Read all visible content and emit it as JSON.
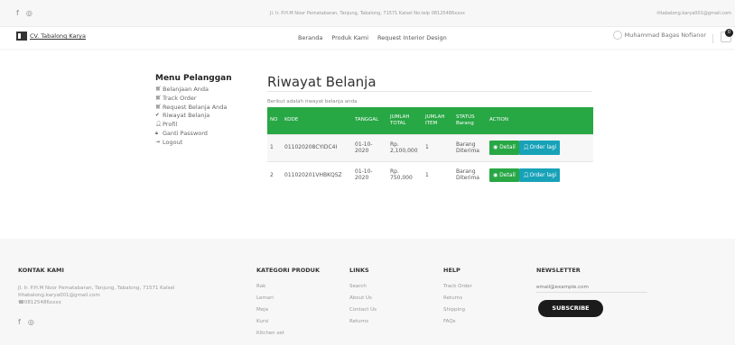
{
  "topbar": {
    "address": "Jl. Ir. P.H.M Noor Pematabaran, Tanjung, Tabalong, 71571 Kalsel No.telp 08125486xxxx",
    "email": "tabalong.karya001@gmail.com"
  },
  "navbar": {
    "brand": "CV. Tabalong Karya",
    "menu": [
      "Beranda",
      "Produk Kami",
      "Request Interior Design"
    ],
    "user_name": "Muhammad Bagas Nofianor",
    "cart_count": "0"
  },
  "sidebar": {
    "title": "Menu Pelanggan",
    "items": [
      {
        "label": "Belanjaan Anda",
        "icon": "cart-icon"
      },
      {
        "label": "Track Order",
        "icon": "cart-icon"
      },
      {
        "label": "Request Belanja Anda",
        "icon": "cart-icon"
      },
      {
        "label": "Riwayat Belanja",
        "icon": "check-icon"
      },
      {
        "label": "Profil",
        "icon": "user-icon"
      },
      {
        "label": "Ganti Password",
        "icon": "lock-icon"
      },
      {
        "label": "Logout",
        "icon": "logout-icon"
      }
    ]
  },
  "main": {
    "title": "Riwayat Belanja",
    "subtitle": "Berikut adalah riwayat belanja anda",
    "table": {
      "headers": [
        "NO",
        "KODE",
        "TANGGAL",
        "JUMLAH TOTAL",
        "JUMLAH ITEM",
        "STATUS Barang",
        "ACTION"
      ],
      "rows": [
        {
          "no": "1",
          "kode": "011020208CYIDC4I",
          "tanggal": "01-10-2020",
          "total": "Rp. 2,100,000",
          "item": "1",
          "status": "Barang Diterima"
        },
        {
          "no": "2",
          "kode": "011020201VHBKQSZ",
          "tanggal": "01-10-2020",
          "total": "Rp. 750,000",
          "item": "1",
          "status": "Barang Diterima"
        }
      ],
      "detail_label": "Detail",
      "order_label": "Order lagi"
    }
  },
  "footer": {
    "kontak": {
      "title": "KONTAK KAMI",
      "address": "Jl. Ir. P.H.M Noor Pematabaran, Tanjung, Tabalong, 71571 Kalsel",
      "email": "tabalong.karya001@gmail.com",
      "phone": "08125486xxxx"
    },
    "kategori": {
      "title": "KATEGORI PRODUK",
      "items": [
        "Rak",
        "Lemari",
        "Meja",
        "Kursi",
        "Kitchen set"
      ]
    },
    "links": {
      "title": "LINKS",
      "items": [
        "Search",
        "About Us",
        "Contact Us",
        "Returns"
      ]
    },
    "help": {
      "title": "HELP",
      "items": [
        "Track Order",
        "Returns",
        "Shipping",
        "FAQs"
      ]
    },
    "newsletter": {
      "title": "NEWSLETTER",
      "placeholder": "email@example.com",
      "button": "SUBSCRIBE"
    }
  },
  "colors": {
    "green": "#28a745",
    "teal": "#17a2b8",
    "dark": "#1b1b1b"
  }
}
